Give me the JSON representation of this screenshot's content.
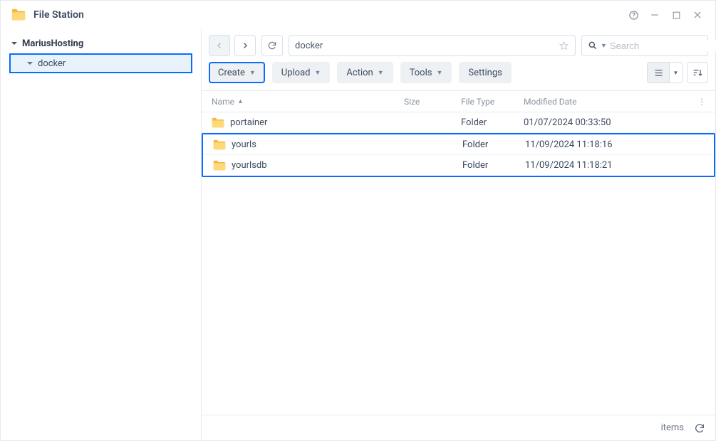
{
  "app": {
    "title": "File Station"
  },
  "sidebar": {
    "root": {
      "label": "MariusHosting"
    },
    "items": [
      {
        "label": "docker",
        "selected": true
      }
    ]
  },
  "nav": {
    "path": "docker"
  },
  "search": {
    "placeholder": "Search"
  },
  "toolbar": {
    "create": "Create",
    "upload": "Upload",
    "action": "Action",
    "tools": "Tools",
    "settings": "Settings"
  },
  "columns": {
    "name": "Name",
    "size": "Size",
    "type": "File Type",
    "date": "Modified Date"
  },
  "rows": [
    {
      "name": "portainer",
      "size": "",
      "type": "Folder",
      "date": "01/07/2024 00:33:50",
      "highlighted": false
    },
    {
      "name": "yourls",
      "size": "",
      "type": "Folder",
      "date": "11/09/2024 11:18:16",
      "highlighted": true
    },
    {
      "name": "yourlsdb",
      "size": "",
      "type": "Folder",
      "date": "11/09/2024 11:18:21",
      "highlighted": true
    }
  ],
  "status": {
    "items_label": "items"
  }
}
